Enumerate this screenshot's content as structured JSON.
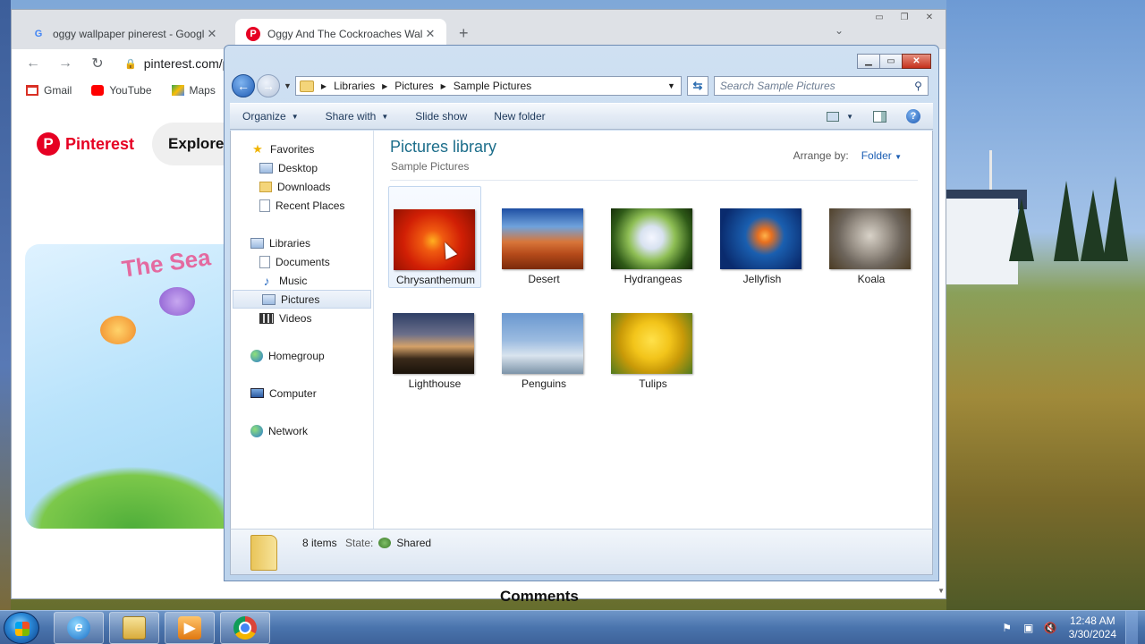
{
  "chrome": {
    "tabs": [
      {
        "title": "oggy wallpaper pinerest - Googl",
        "icon": "google-g-icon"
      },
      {
        "title": "Oggy And The Cockroaches Wall",
        "icon": "pinterest-icon"
      }
    ],
    "url": "pinterest.com/p",
    "bookmarks": [
      {
        "label": "Gmail",
        "icon": "gmail-icon"
      },
      {
        "label": "YouTube",
        "icon": "youtube-icon"
      },
      {
        "label": "Maps",
        "icon": "maps-icon"
      }
    ],
    "page": {
      "brand": "Pinterest",
      "explore": "Explore",
      "pin_title": "The Sea",
      "comments": "Comments"
    }
  },
  "explorer": {
    "breadcrumbs": [
      "Libraries",
      "Pictures",
      "Sample Pictures"
    ],
    "search_placeholder": "Search Sample Pictures",
    "commands": [
      "Organize",
      "Share with",
      "Slide show",
      "New folder"
    ],
    "nav": {
      "favorites": "Favorites",
      "favorites_items": [
        "Desktop",
        "Downloads",
        "Recent Places"
      ],
      "libraries": "Libraries",
      "libraries_items": [
        "Documents",
        "Music",
        "Pictures",
        "Videos"
      ],
      "homegroup": "Homegroup",
      "computer": "Computer",
      "network": "Network",
      "selected": "Pictures"
    },
    "library_title": "Pictures library",
    "library_subtitle": "Sample Pictures",
    "arrange_label": "Arrange by:",
    "arrange_value": "Folder",
    "files": [
      {
        "name": "Chrysanthemum",
        "selected": true
      },
      {
        "name": "Desert",
        "selected": false
      },
      {
        "name": "Hydrangeas",
        "selected": false
      },
      {
        "name": "Jellyfish",
        "selected": false
      },
      {
        "name": "Koala",
        "selected": false
      },
      {
        "name": "Lighthouse",
        "selected": false
      },
      {
        "name": "Penguins",
        "selected": false
      },
      {
        "name": "Tulips",
        "selected": false
      }
    ],
    "details": {
      "count": "8 items",
      "state_label": "State:",
      "state_value": "Shared"
    }
  },
  "taskbar": {
    "time": "12:48 AM",
    "date": "3/30/2024"
  }
}
